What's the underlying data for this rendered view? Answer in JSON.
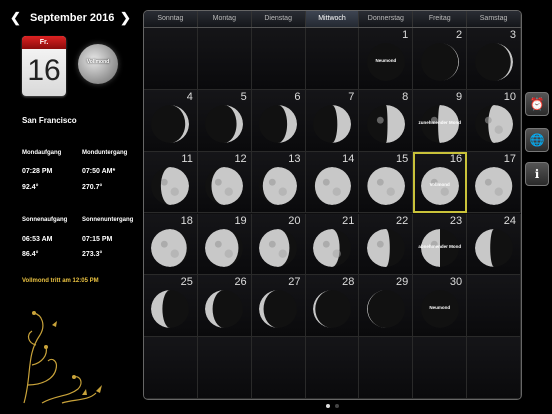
{
  "header": {
    "prev_icon": "chevron-left-icon",
    "next_icon": "chevron-right-icon",
    "month": "September 2016"
  },
  "selected": {
    "weekday": "Fr.",
    "day": "16",
    "phase_label": "Vollmond"
  },
  "location": "San Francisco",
  "moon": {
    "rise_label": "Mondaufgang",
    "set_label": "Monduntergang",
    "rise": "07:28 PM",
    "set": "07:50 AM*",
    "rise_az": "92.4°",
    "set_az": "270.7°"
  },
  "sun": {
    "rise_label": "Sonnenaufgang",
    "set_label": "Sonnenuntergang",
    "rise": "06:53 AM",
    "set": "07:15 PM",
    "rise_az": "86.4°",
    "set_az": "273.3°"
  },
  "event": "Vollmond tritt am 12:05 PM",
  "weekdays": [
    "Sonntag",
    "Montag",
    "Dienstag",
    "Mittwoch",
    "Donnerstag",
    "Freitag",
    "Samstag"
  ],
  "active_weekday": 3,
  "days": [
    {
      "d": "1",
      "lit": 0,
      "label": "Neumond"
    },
    {
      "d": "2",
      "lit": 0.02
    },
    {
      "d": "3",
      "lit": 0.06
    },
    {
      "d": "4",
      "lit": 0.1
    },
    {
      "d": "5",
      "lit": 0.17
    },
    {
      "d": "6",
      "lit": 0.26
    },
    {
      "d": "7",
      "lit": 0.36
    },
    {
      "d": "8",
      "lit": 0.46
    },
    {
      "d": "9",
      "lit": 0.55,
      "label": "zunehmender Mond"
    },
    {
      "d": "10",
      "lit": 0.65
    },
    {
      "d": "11",
      "lit": 0.74
    },
    {
      "d": "12",
      "lit": 0.83
    },
    {
      "d": "13",
      "lit": 0.9
    },
    {
      "d": "14",
      "lit": 0.95
    },
    {
      "d": "15",
      "lit": 0.99
    },
    {
      "d": "16",
      "lit": 1,
      "label": "Vollmond"
    },
    {
      "d": "17",
      "lit": 0.98
    },
    {
      "d": "18",
      "lit": 0.94
    },
    {
      "d": "19",
      "lit": 0.88
    },
    {
      "d": "20",
      "lit": 0.8
    },
    {
      "d": "21",
      "lit": 0.7
    },
    {
      "d": "22",
      "lit": 0.6
    },
    {
      "d": "23",
      "lit": 0.5,
      "label": "abnehmender Mond"
    },
    {
      "d": "24",
      "lit": 0.4
    },
    {
      "d": "25",
      "lit": 0.3
    },
    {
      "d": "26",
      "lit": 0.2
    },
    {
      "d": "27",
      "lit": 0.12
    },
    {
      "d": "28",
      "lit": 0.06
    },
    {
      "d": "29",
      "lit": 0.02
    },
    {
      "d": "30",
      "lit": 0,
      "label": "Neumond"
    }
  ],
  "first_weekday": 4,
  "selected_day": "16",
  "side_buttons": [
    "alarm-clock-icon",
    "globe-icon",
    "info-icon"
  ],
  "page_indicator": {
    "pages": 2,
    "current": 0
  }
}
